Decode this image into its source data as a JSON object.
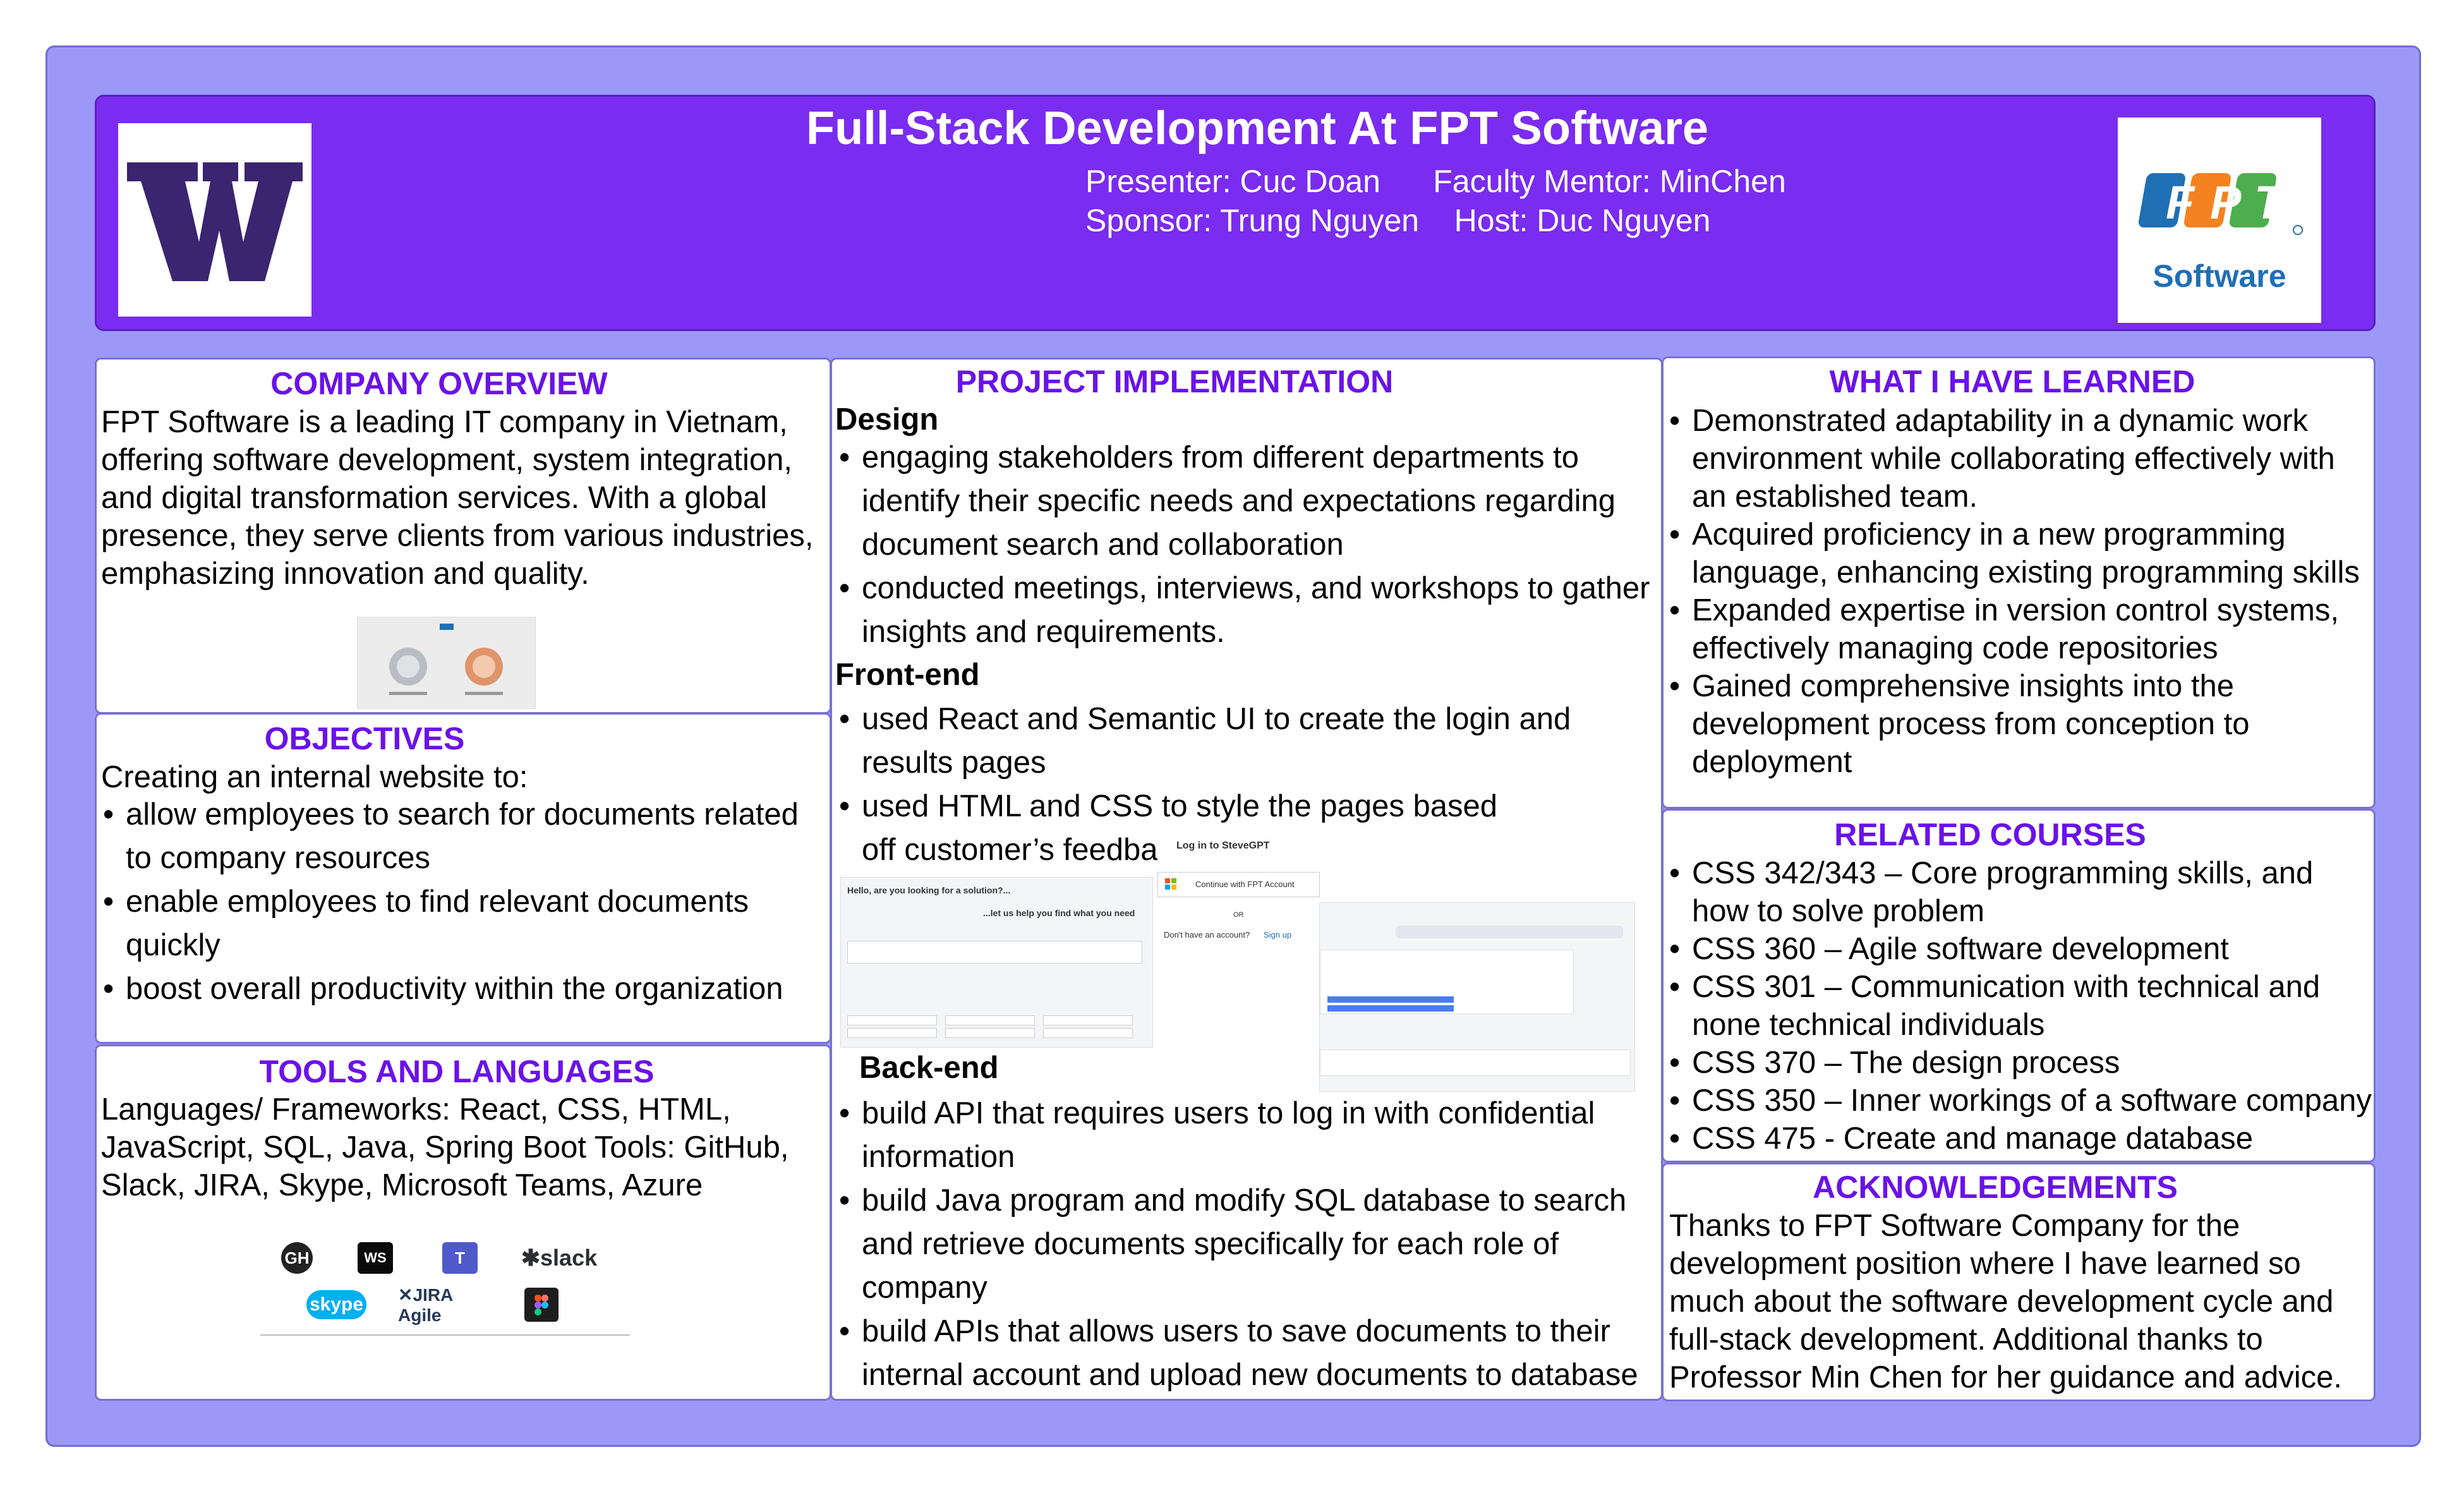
{
  "header": {
    "title": "Full-Stack Development At FPT Software",
    "line1": "Presenter: Cuc Doan      Faculty Mentor: MinChen",
    "line2": "Sponsor: Trung Nguyen    Host: Duc Nguyen",
    "logo_right_text": "Software"
  },
  "company_overview": {
    "title": "COMPANY OVERVIEW",
    "text": "FPT Software is a leading IT company in Vietnam, offering software development, system integration, and digital transformation services. With a global presence, they serve clients from various industries, emphasizing innovation and quality."
  },
  "objectives": {
    "title": "OBJECTIVES",
    "intro": "Creating an internal website to:",
    "items": [
      "allow employees to search for documents related to company resources",
      "enable employees to find relevant documents quickly",
      "boost overall productivity within the organization"
    ]
  },
  "tools": {
    "title": "TOOLS AND LANGUAGES",
    "text": "Languages/ Frameworks: React, CSS, HTML, JavaScript, SQL, Java, Spring Boot Tools: GitHub, Slack, JIRA, Skype, Microsoft Teams, Azure",
    "icons": [
      "github-icon",
      "webstorm-icon",
      "teams-icon",
      "slack-icon",
      "skype-icon",
      "jira-icon",
      "figma-icon"
    ]
  },
  "project": {
    "title": "PROJECT IMPLEMENTATION",
    "design_heading": "Design",
    "design_items": [
      "engaging stakeholders from different departments to identify their specific needs and expectations regarding document search and collaboration",
      "conducted meetings, interviews, and workshops to gather insights and requirements."
    ],
    "frontend_heading": "Front-end",
    "frontend_items": [
      "used React and Semantic UI to create the login and results pages",
      "used HTML and CSS to style the pages based off customer’s feedback"
    ],
    "backend_heading": "Back-end",
    "backend_items": [
      "build API that requires users to log in with confidential information",
      "build Java program and modify SQL database to search and retrieve documents specifically for each role of company",
      "build APIs that allows users to save documents to their internal account and upload new documents to database"
    ],
    "screens": {
      "login_title": "Log in to SteveGPT",
      "login_button": "Continue with FPT Account",
      "login_or": "OR",
      "login_signup_prefix": "Don't have an account?",
      "login_signup_link": "Sign up",
      "chat_greeting": "Hello, are you looking for a solution?...",
      "chat_help": "...let us help you find what you need"
    }
  },
  "learned": {
    "title": "WHAT I HAVE LEARNED",
    "items": [
      "Demonstrated adaptability in a dynamic work environment while collaborating effectively with an established team.",
      "Acquired proficiency in a new programming language, enhancing existing programming skills",
      "Expanded expertise in version control systems, effectively managing code repositories",
      "Gained comprehensive insights into the development process from conception to deployment"
    ]
  },
  "courses": {
    "title": "RELATED COURSES",
    "items": [
      "CSS 342/343 – Core programming skills, and how to solve problem",
      "CSS 360 – Agile software development",
      "CSS 301 – Communication with technical and none technical individuals",
      "CSS 370 – The design process",
      "CSS 350 – Inner workings of a software company",
      "CSS 475 - Create and manage database"
    ]
  },
  "ack": {
    "title": "ACKNOWLEDGEMENTS",
    "text": "Thanks to FPT Software Company for the development position where I have learned so much about the software development cycle and full-stack development. Additional thanks to Professor Min Chen for her guidance and advice."
  },
  "colors": {
    "frame": "#9b98f7",
    "header": "#7a2cf0",
    "heading": "#6a12ea",
    "uw_purple": "#3b2470",
    "fpt_blue": "#1f6fb5",
    "fpt_orange": "#f58220",
    "fpt_green": "#4cae4c"
  }
}
